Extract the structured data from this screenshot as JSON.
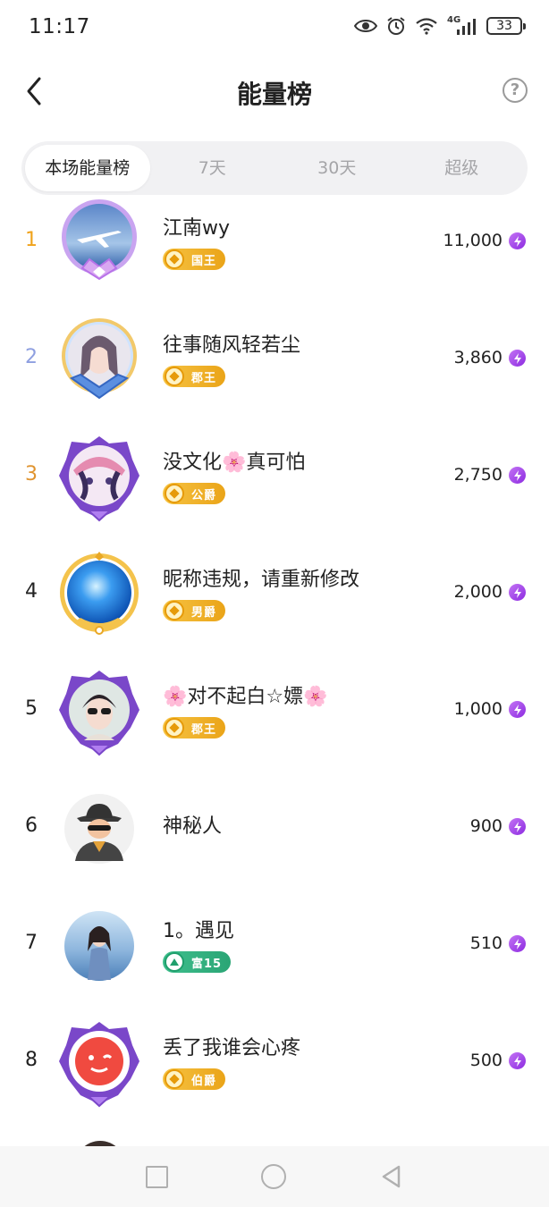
{
  "status_bar": {
    "time": "11:17",
    "network_label": "4G",
    "battery": "33"
  },
  "header": {
    "title": "能量榜",
    "back_icon": "chevron-left-icon",
    "help_icon": "question-circle-icon",
    "help_glyph": "?"
  },
  "tabs": [
    {
      "label": "本场能量榜",
      "active": true
    },
    {
      "label": "7天",
      "active": false
    },
    {
      "label": "30天",
      "active": false
    },
    {
      "label": "超级",
      "active": false
    }
  ],
  "rank_colors": {
    "1": "#f0a31b",
    "2": "#8e9fe0",
    "3": "#e09430",
    "default": "#222222"
  },
  "energy_icon": "lightning-bolt-icon",
  "rows": [
    {
      "rank": "1",
      "name": "江南wy",
      "badge": "国王",
      "badge_type": "gold",
      "score": "11,000",
      "avatar": "airplane-avatar"
    },
    {
      "rank": "2",
      "name": "往事随风轻若尘",
      "badge": "郡王",
      "badge_type": "gold",
      "score": "3,860",
      "avatar": "woman-avatar"
    },
    {
      "rank": "3",
      "name": "没文化🌸真可怕",
      "badge": "公爵",
      "badge_type": "gold",
      "score": "2,750",
      "avatar": "anime-avatar"
    },
    {
      "rank": "4",
      "name": "昵称违规，请重新修改",
      "badge": "男爵",
      "badge_type": "gold",
      "score": "2,000",
      "avatar": "blue-crystal-avatar"
    },
    {
      "rank": "5",
      "name": "🌸对不起白☆嫖🌸",
      "badge": "郡王",
      "badge_type": "gold",
      "score": "1,000",
      "avatar": "girl-sunglasses-avatar"
    },
    {
      "rank": "6",
      "name": "神秘人",
      "badge": "",
      "badge_type": "none",
      "score": "900",
      "avatar": "mystery-man-avatar"
    },
    {
      "rank": "7",
      "name": "1。遇见",
      "badge": "富15",
      "badge_type": "green",
      "score": "510",
      "avatar": "seaside-woman-avatar"
    },
    {
      "rank": "8",
      "name": "丢了我谁会心疼",
      "badge": "伯爵",
      "badge_type": "gold",
      "score": "500",
      "avatar": "red-smiley-avatar"
    }
  ],
  "nav": {
    "recent_icon": "square-icon",
    "home_icon": "circle-icon",
    "back_icon": "triangle-back-icon"
  }
}
